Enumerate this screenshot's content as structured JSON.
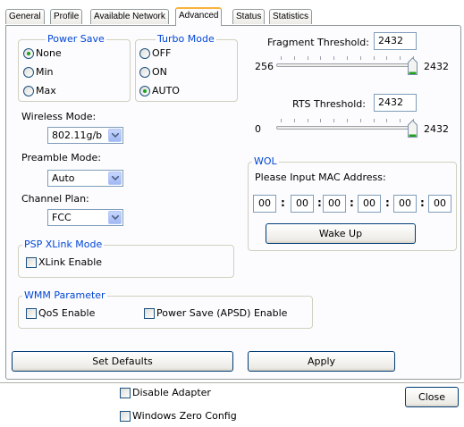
{
  "tabs": [
    {
      "label": "General"
    },
    {
      "label": "Profile"
    },
    {
      "label": "Available Network"
    },
    {
      "label": "Advanced"
    },
    {
      "label": "Status"
    },
    {
      "label": "Statistics"
    }
  ],
  "active_tab": "Advanced",
  "power_save": {
    "title": "Power Save",
    "options": [
      {
        "label": "None",
        "selected": true
      },
      {
        "label": "Min",
        "selected": false
      },
      {
        "label": "Max",
        "selected": false
      }
    ]
  },
  "turbo_mode": {
    "title": "Turbo Mode",
    "options": [
      {
        "label": "OFF",
        "selected": false
      },
      {
        "label": "ON",
        "selected": false
      },
      {
        "label": "AUTO",
        "selected": true
      }
    ]
  },
  "wireless_mode": {
    "label": "Wireless Mode:",
    "value": "802.11g/b"
  },
  "preamble_mode": {
    "label": "Preamble Mode:",
    "value": "Auto"
  },
  "channel_plan": {
    "label": "Channel Plan:",
    "value": "FCC"
  },
  "fragment": {
    "label": "Fragment Threshold:",
    "value": "2432",
    "min": "256",
    "max": "2432",
    "level": 1.0
  },
  "rts": {
    "label": "RTS Threshold:",
    "value": "2432",
    "min": "0",
    "max": "2432",
    "level": 1.0
  },
  "wol": {
    "title": "WOL",
    "prompt": "Please Input MAC Address:",
    "octets": [
      "00",
      "00",
      "00",
      "00",
      "00",
      "00"
    ],
    "wake_button": "Wake Up"
  },
  "psp": {
    "title": "PSP XLink Mode",
    "xlink_label": "XLink Enable",
    "xlink_checked": false
  },
  "wmm": {
    "title": "WMM Parameter",
    "qos_label": "QoS Enable",
    "qos_checked": false,
    "apsd_label": "Power Save (APSD) Enable",
    "apsd_checked": false
  },
  "buttons": {
    "set_defaults": "Set Defaults",
    "apply": "Apply",
    "close": "Close"
  },
  "footer": {
    "disable_adapter": "Disable Adapter",
    "windows_zero_config": "Windows Zero Config"
  },
  "colors": {
    "group_title": "#0046d5",
    "active_tab_accent": "#f8b33b",
    "slider_thumb": "#21a121"
  }
}
